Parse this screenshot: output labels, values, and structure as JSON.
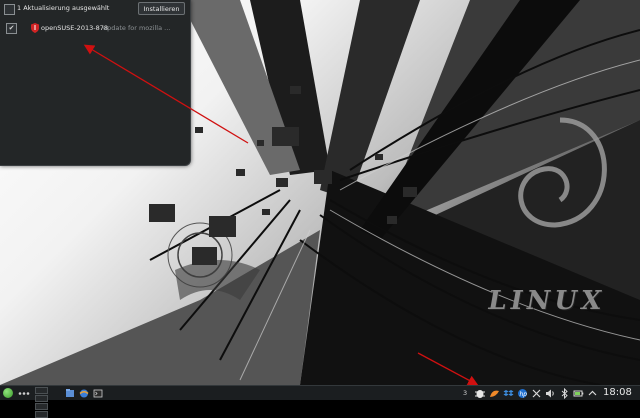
{
  "popup": {
    "header_text": "1 Aktualisierung ausgewählt",
    "install_button": "Installieren",
    "updates": [
      {
        "name": "openSUSE-2013-878",
        "description": "update for mozilla ..."
      }
    ]
  },
  "wallpaper": {
    "logo_text": "LINUX"
  },
  "taskbar": {
    "tray_count": "3",
    "clock": "18:08"
  },
  "colors": {
    "popup_bg": "#232627",
    "taskbar_bg": "#1b1e20",
    "arrow": "#d01010",
    "start_orb": "#5cc24a"
  }
}
